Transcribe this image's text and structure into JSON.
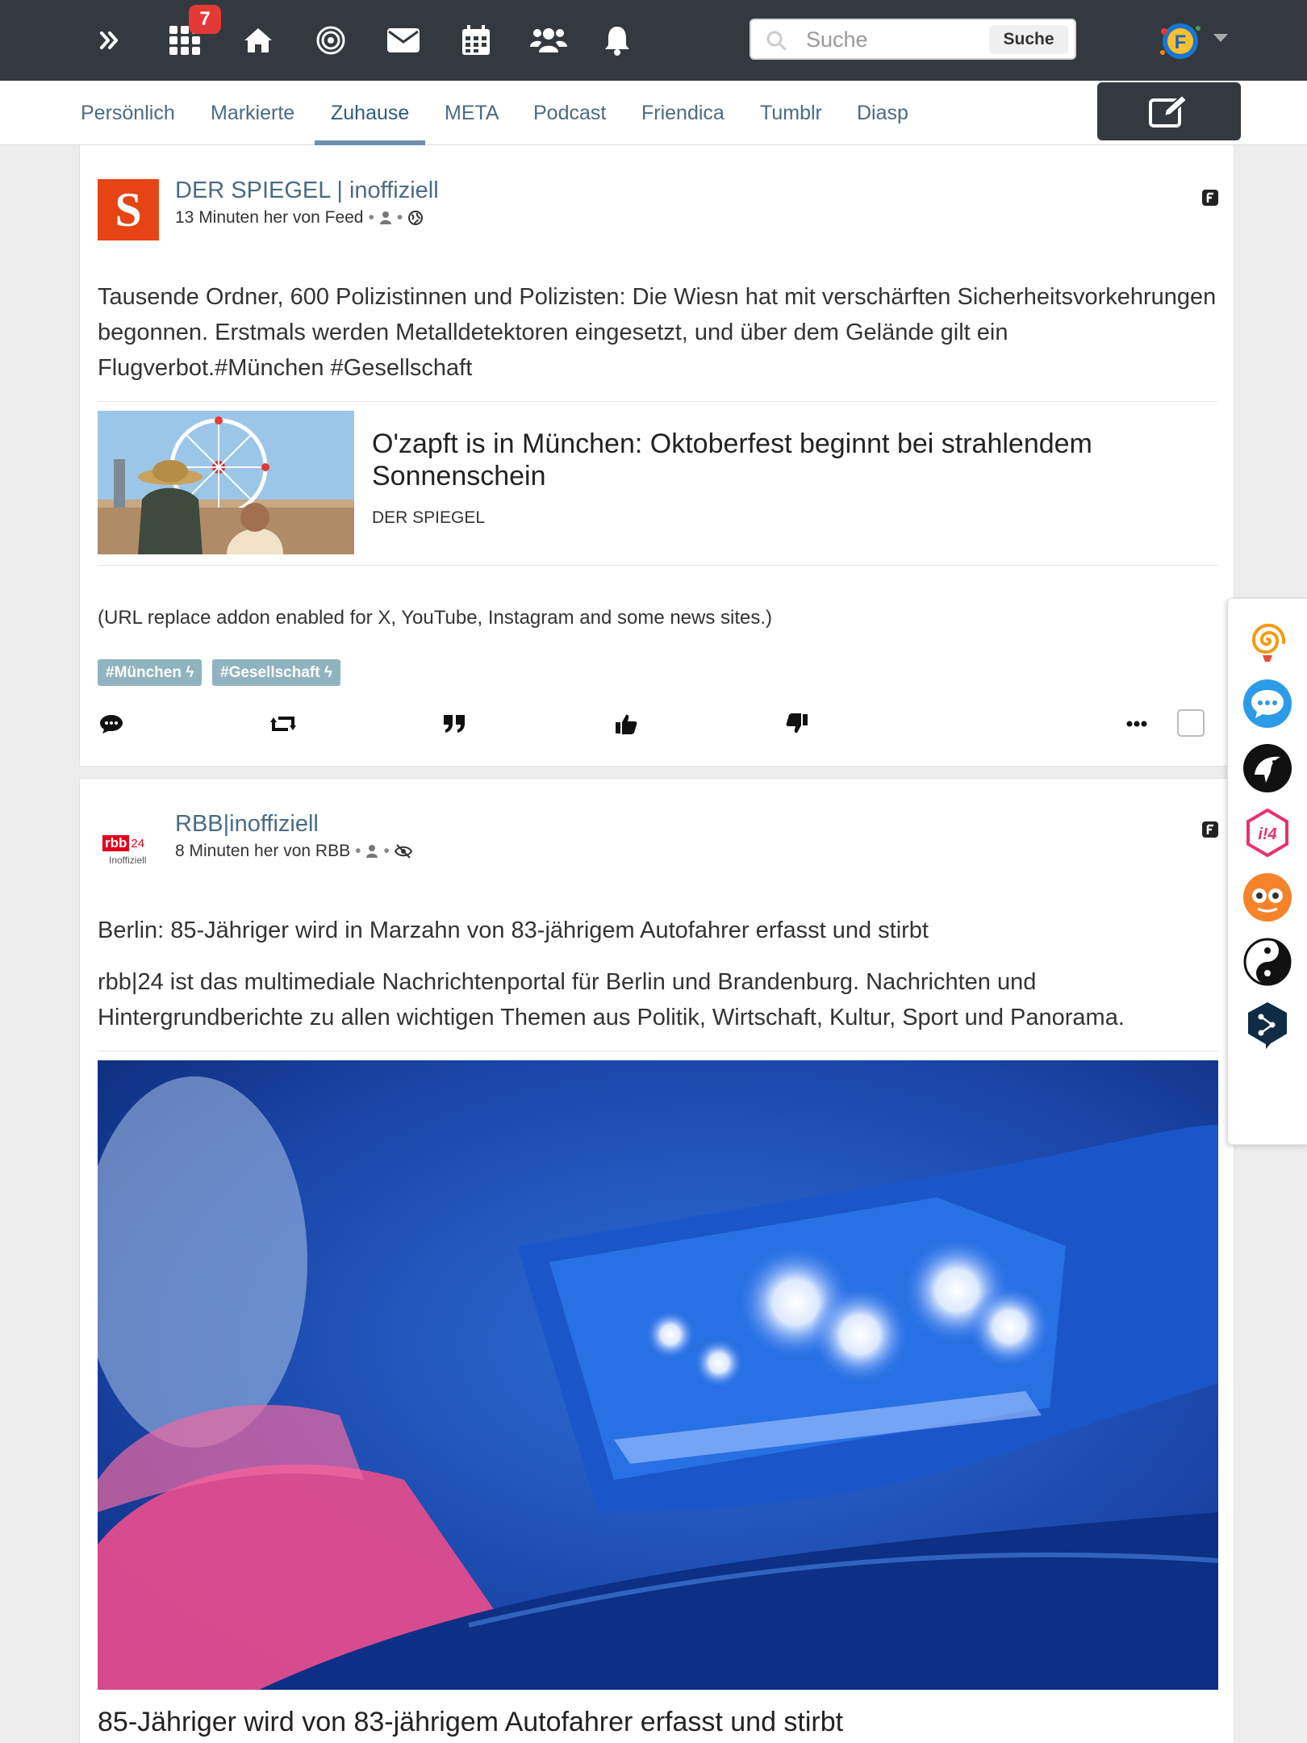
{
  "topbar": {
    "icons": [
      "menu-expand-icon",
      "apps-grid-icon",
      "home-icon",
      "target-icon",
      "mail-icon",
      "calendar-icon",
      "users-icon",
      "bell-icon"
    ],
    "notification_count": "7",
    "search": {
      "placeholder": "Suche",
      "button_label": "Suche"
    }
  },
  "tabs": [
    {
      "label": "Persönlich",
      "active": false
    },
    {
      "label": "Markierte",
      "active": false
    },
    {
      "label": "Zuhause",
      "active": true
    },
    {
      "label": "META",
      "active": false
    },
    {
      "label": "Podcast",
      "active": false
    },
    {
      "label": "Friendica",
      "active": false
    },
    {
      "label": "Tumblr",
      "active": false
    },
    {
      "label": "Diasp",
      "active": false
    }
  ],
  "posts": [
    {
      "author": "DER SPIEGEL | inoffiziell",
      "meta": "13 Minuten her von Feed",
      "avatar_letter": "S",
      "text": "Tausende Ordner, 600 Polizistinnen und Polizisten: Die Wiesn hat mit verschärften Sicherheitsvorkehrungen begonnen. Erstmals werden Metalldetektoren eingesetzt, und über dem Gelände gilt ein Flugverbot.#München #Gesellschaft",
      "preview": {
        "title": "O'zapft is in München: Oktoberfest beginnt bei strahlendem Sonnenschein",
        "source": "DER SPIEGEL"
      },
      "note": "(URL replace addon enabled for X, YouTube, Instagram and some news sites.)",
      "tags": [
        "#München ϟ",
        "#Gesellschaft ϟ"
      ]
    },
    {
      "author": "RBB|inoffiziell",
      "meta": "8 Minuten her von RBB",
      "avatar_logo": "rbb",
      "avatar_logo_num": "24",
      "avatar_sub": "Inoffiziell",
      "headline": "Berlin: 85-Jähriger wird in Marzahn von 83-jährigem Autofahrer erfasst und stirbt",
      "text": "rbb|24 ist das multimediale Nachrichtenportal für Berlin und Brandenburg. Nachrichten und Hintergrundberichte zu allen wichtigen Themen aus Politik, Wirtschaft, Kultur, Sport und Panorama.",
      "image_title": "85-Jähriger wird von 83-jährigem Autofahrer erfasst und stirbt"
    }
  ],
  "actions": [
    "comment-icon",
    "share-icon",
    "quote-icon",
    "like-icon",
    "dislike-icon",
    "more-icon"
  ],
  "dock": [
    "spiral-icon",
    "chat-icon",
    "bird-icon",
    "hex-icon",
    "mascot-icon",
    "yinyang-icon",
    "deepl-icon"
  ],
  "colors": {
    "navbar": "#34393f",
    "link": "#4a6b85",
    "tag": "#8fb3c0",
    "badge": "#e53935",
    "spiegel": "#e64415",
    "rbb": "#e3001b"
  }
}
